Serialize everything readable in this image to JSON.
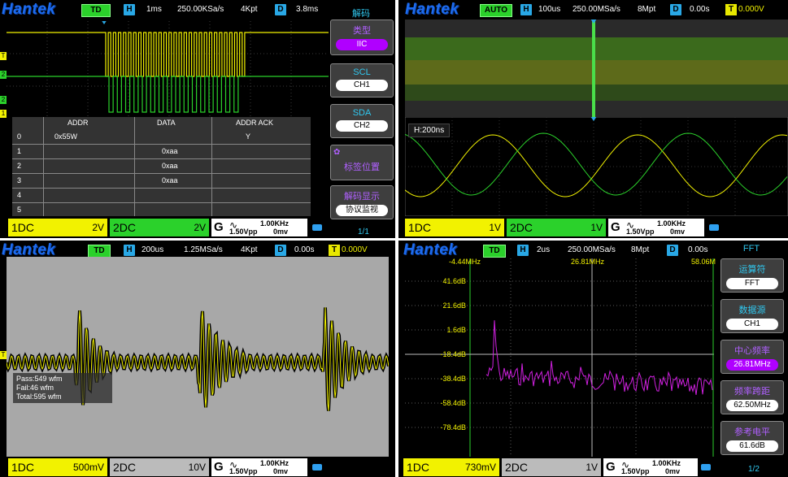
{
  "panels": {
    "decode": {
      "logo": "Hantek",
      "mode": "TD",
      "h_tag": "H",
      "timebase": "1ms",
      "sample_rate": "250.00KSa/s",
      "memory": "4Kpt",
      "d_tag": "D",
      "delay": "3.8ms",
      "menu_title": "解码",
      "menu": [
        {
          "label": "类型",
          "value": "IIC"
        },
        {
          "label": "SCL",
          "value": "CH1"
        },
        {
          "label": "SDA",
          "value": "CH2"
        },
        {
          "label": "标签位置",
          "value": ""
        },
        {
          "label": "解码显示",
          "value": "协议监视"
        }
      ],
      "page": "1/1",
      "table": {
        "headers": [
          "ADDR",
          "DATA",
          "ADDR ACK"
        ],
        "rows": [
          {
            "idx": "0",
            "addr": "0x55W",
            "data": "",
            "ack": "Y"
          },
          {
            "idx": "1",
            "addr": "",
            "data": "0xaa",
            "ack": ""
          },
          {
            "idx": "2",
            "addr": "",
            "data": "0xaa",
            "ack": ""
          },
          {
            "idx": "3",
            "addr": "",
            "data": "0xaa",
            "ack": ""
          },
          {
            "idx": "4",
            "addr": "",
            "data": "",
            "ack": ""
          },
          {
            "idx": "5",
            "addr": "",
            "data": "",
            "ack": ""
          }
        ]
      },
      "ch1": {
        "name": "1DC",
        "scale": "2V"
      },
      "ch2": {
        "name": "2DC",
        "scale": "2V"
      },
      "gen": {
        "g": "G",
        "wave": "∿",
        "vpp": "1.50Vpp",
        "freq": "1.00KHz",
        "offset": "0mv"
      },
      "markers": {
        "t": "T",
        "one": "1",
        "two": "2"
      }
    },
    "zoom": {
      "logo": "Hantek",
      "mode": "AUTO",
      "h_tag": "H",
      "timebase": "100us",
      "sample_rate": "250.00MSa/s",
      "memory": "8Mpt",
      "d_tag": "D",
      "delay": "0.00s",
      "t_tag": "T",
      "trigger": "0.000V",
      "zoom_label": "H:200ns",
      "ch1": {
        "name": "1DC",
        "scale": "1V"
      },
      "ch2": {
        "name": "2DC",
        "scale": "1V"
      },
      "gen": {
        "g": "G",
        "wave": "∿",
        "vpp": "1.50Vpp",
        "freq": "1.00KHz",
        "offset": "0mv"
      }
    },
    "mask": {
      "logo": "Hantek",
      "mode": "TD",
      "h_tag": "H",
      "timebase": "200us",
      "sample_rate": "1.25MSa/s",
      "memory": "4Kpt",
      "d_tag": "D",
      "delay": "0.00s",
      "t_tag": "T",
      "trigger": "0.000V",
      "stats": [
        "Pass:549 wfm",
        "Fail:46 wfm",
        "Total:595 wfm"
      ],
      "ch1": {
        "name": "1DC",
        "scale": "500mV"
      },
      "ch2": {
        "name": "2DC",
        "scale": "10V"
      },
      "gen": {
        "g": "G",
        "wave": "∿",
        "vpp": "1.50Vpp",
        "freq": "1.00KHz",
        "offset": "0mv"
      }
    },
    "fft": {
      "logo": "Hantek",
      "mode": "TD",
      "h_tag": "H",
      "timebase": "2us",
      "sample_rate": "250.00MSa/s",
      "memory": "8Mpt",
      "d_tag": "D",
      "delay": "0.00s",
      "menu_title": "FFT",
      "freq_left": "-4.44MHz",
      "freq_center": "26.81MHz",
      "freq_right": "58.06M",
      "db_labels": [
        "41.6dB",
        "21.6dB",
        "1.6dB",
        "-18.4dB",
        "-38.4dB",
        "-58.4dB",
        "-78.4dB"
      ],
      "menu": [
        {
          "label": "运算符",
          "value": "FFT"
        },
        {
          "label": "数据源",
          "value": "CH1"
        },
        {
          "label": "中心频率",
          "value": "26.81MHz"
        },
        {
          "label": "频率跨距",
          "value": "62.50MHz"
        },
        {
          "label": "参考电平",
          "value": "61.6dB"
        }
      ],
      "page": "1/2",
      "ch1": {
        "name": "1DC",
        "scale": "730mV"
      },
      "ch2": {
        "name": "2DC",
        "scale": "1V"
      },
      "gen": {
        "g": "G",
        "wave": "∿",
        "vpp": "1.50Vpp",
        "freq": "1.00KHz",
        "offset": "0mv"
      }
    }
  },
  "colors": {
    "ch1": "#f2f200",
    "ch2": "#2bd12b",
    "math": "#d020e0",
    "accent": "#30c8f0"
  }
}
